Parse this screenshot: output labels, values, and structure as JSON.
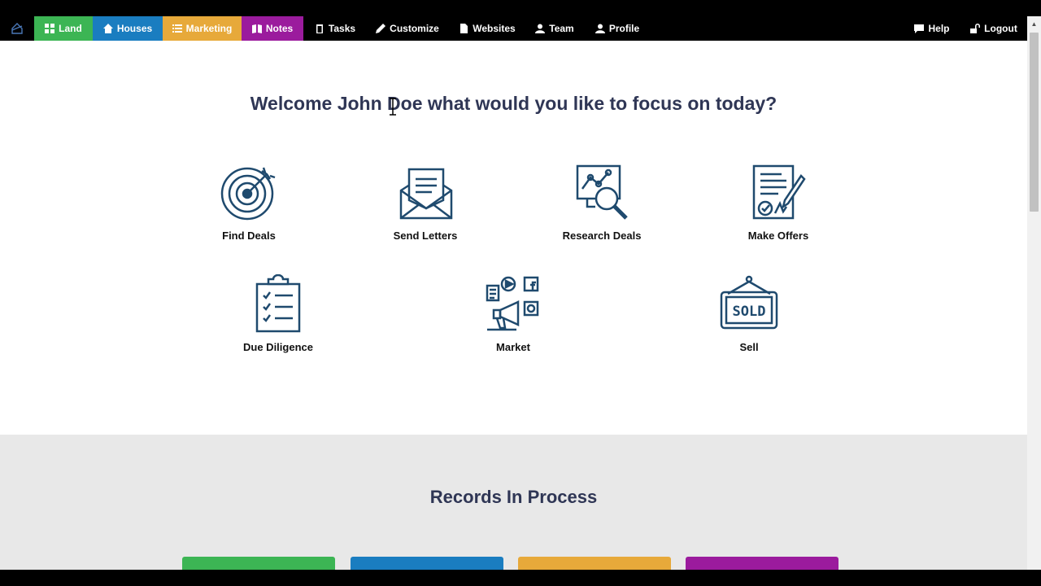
{
  "nav": {
    "home_icon": "house-outline-icon",
    "items": [
      {
        "label": "Land",
        "icon": "grid-icon",
        "color": "#3cb554"
      },
      {
        "label": "Houses",
        "icon": "home-icon",
        "color": "#1a7dc0"
      },
      {
        "label": "Marketing",
        "icon": "list-icon",
        "color": "#e7a93a"
      },
      {
        "label": "Notes",
        "icon": "book-icon",
        "color": "#9b1b9d"
      },
      {
        "label": "Tasks",
        "icon": "clipboard-icon"
      },
      {
        "label": "Customize",
        "icon": "pencil-icon"
      },
      {
        "label": "Websites",
        "icon": "file-icon"
      },
      {
        "label": "Team",
        "icon": "team-icon"
      },
      {
        "label": "Profile",
        "icon": "user-icon"
      },
      {
        "label": "Help",
        "icon": "chat-icon"
      },
      {
        "label": "Logout",
        "icon": "unlock-icon"
      }
    ]
  },
  "welcome": {
    "title": "Welcome John Doe what would you like to focus on today?"
  },
  "tiles": [
    {
      "label": "Find Deals",
      "icon": "target-icon"
    },
    {
      "label": "Send Letters",
      "icon": "envelope-icon"
    },
    {
      "label": "Research Deals",
      "icon": "research-icon"
    },
    {
      "label": "Make Offers",
      "icon": "contract-icon"
    },
    {
      "label": "Due Diligence",
      "icon": "checklist-icon"
    },
    {
      "label": "Market",
      "icon": "megaphone-icon"
    },
    {
      "label": "Sell",
      "icon": "sold-sign-icon"
    }
  ],
  "records": {
    "title": "Records In Process",
    "card_colors": [
      "#3cb554",
      "#1a7dc0",
      "#e7a93a",
      "#9b1b9d"
    ]
  },
  "colors": {
    "icon_stroke": "#1f4a6e",
    "heading": "#2f3655"
  }
}
